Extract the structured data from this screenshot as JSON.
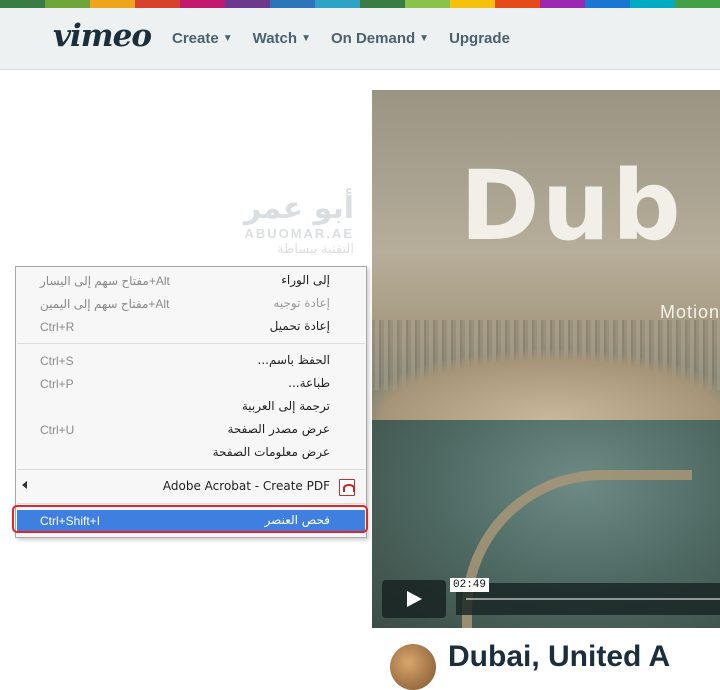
{
  "colors": {
    "rainbow": [
      "#3a7d44",
      "#6fa53b",
      "#f0a31c",
      "#d6432c",
      "#c2186e",
      "#6c3a8c",
      "#2d74b8",
      "#2fa3c6",
      "#3a7d44",
      "#8bc34a",
      "#f4c20d",
      "#e64a19",
      "#9c27b0",
      "#1976d2",
      "#00acc1",
      "#43a047"
    ],
    "menu_highlight": "#3f7fdf",
    "annotation_box": "#e0262a"
  },
  "header": {
    "logo": "vimeo",
    "nav": [
      {
        "label": "Create",
        "has_dropdown": true
      },
      {
        "label": "Watch",
        "has_dropdown": true
      },
      {
        "label": "On Demand",
        "has_dropdown": true
      },
      {
        "label": "Upgrade",
        "has_dropdown": false
      }
    ]
  },
  "watermark": {
    "arabic": "أبو عمر",
    "latin": "ABUOMAR.AE",
    "tagline": "التقنية ببساطة"
  },
  "video": {
    "title_overlay": "Dub",
    "subtitle_overlay": "Motion",
    "time": "02:49",
    "below_title": "Dubai, United A"
  },
  "context_menu": {
    "items": [
      {
        "label": "إلى الوراء",
        "shortcut": "مفتاح سهم إلى اليسار+Alt",
        "disabled": false
      },
      {
        "label": "إعادة توجيه",
        "shortcut": "مفتاح سهم إلى اليمين+Alt",
        "disabled": true
      },
      {
        "label": "إعادة تحميل",
        "shortcut": "Ctrl+R",
        "disabled": false
      },
      {
        "label": "الحفظ باسم...",
        "shortcut": "Ctrl+S",
        "disabled": false
      },
      {
        "label": "طباعة...",
        "shortcut": "Ctrl+P",
        "disabled": false
      },
      {
        "label": "ترجمة إلى العربية",
        "shortcut": "",
        "disabled": false
      },
      {
        "label": "عرض مصدر الصفحة",
        "shortcut": "Ctrl+U",
        "disabled": false
      },
      {
        "label": "عرض معلومات الصفحة",
        "shortcut": "",
        "disabled": false
      },
      {
        "label": "Adobe Acrobat - Create PDF",
        "shortcut": "",
        "disabled": false
      },
      {
        "label": "فحص العنصر",
        "shortcut": "Ctrl+Shift+I",
        "disabled": false
      }
    ]
  }
}
